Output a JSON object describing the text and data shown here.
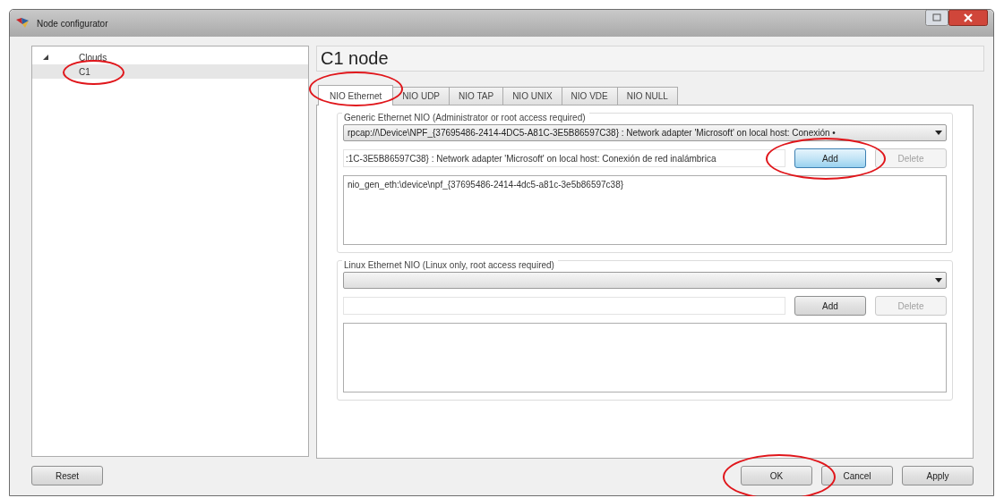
{
  "window": {
    "title": "Node configurator"
  },
  "tree": [
    {
      "label": "Clouds",
      "expanded": true,
      "selected": false,
      "annotated": false,
      "children": [
        {
          "label": "C1",
          "selected": true,
          "annotated": true
        }
      ]
    }
  ],
  "node_title": "C1 node",
  "tabs": [
    {
      "label": "NIO Ethernet",
      "selected": true,
      "annotated": true
    },
    {
      "label": "NIO UDP",
      "selected": false,
      "annotated": false
    },
    {
      "label": "NIO TAP",
      "selected": false,
      "annotated": false
    },
    {
      "label": "NIO UNIX",
      "selected": false,
      "annotated": false
    },
    {
      "label": "NIO VDE",
      "selected": false,
      "annotated": false
    },
    {
      "label": "NIO NULL",
      "selected": false,
      "annotated": false
    }
  ],
  "groups": [
    {
      "title": "Generic Ethernet NIO (Administrator or root access required)",
      "combo_value": "rpcap://\\Device\\NPF_{37695486-2414-4DC5-A81C-3E5B86597C38} : Network adapter 'Microsoft' on local host: Conexión •",
      "input_value": ":1C-3E5B86597C38} : Network adapter 'Microsoft' on local host: Conexión de red inalámbrica",
      "add_button": {
        "label": "Add",
        "focused": true,
        "annotated": true
      },
      "delete_button": {
        "label": "Delete",
        "disabled": true
      },
      "list_items": [
        "nio_gen_eth:\\device\\npf_{37695486-2414-4dc5-a81c-3e5b86597c38}"
      ]
    },
    {
      "title": "Linux Ethernet NIO (Linux only, root access required)",
      "add_button": {
        "label": "Add",
        "focused": false,
        "annotated": false
      },
      "delete_button": {
        "label": "Delete",
        "disabled": true
      }
    }
  ],
  "left_buttons": [
    {
      "label": "Reset",
      "annotated": false
    }
  ],
  "right_buttons": [
    {
      "label": "OK",
      "annotated": true
    },
    {
      "label": "Cancel",
      "annotated": false
    },
    {
      "label": "Apply",
      "annotated": false
    }
  ]
}
